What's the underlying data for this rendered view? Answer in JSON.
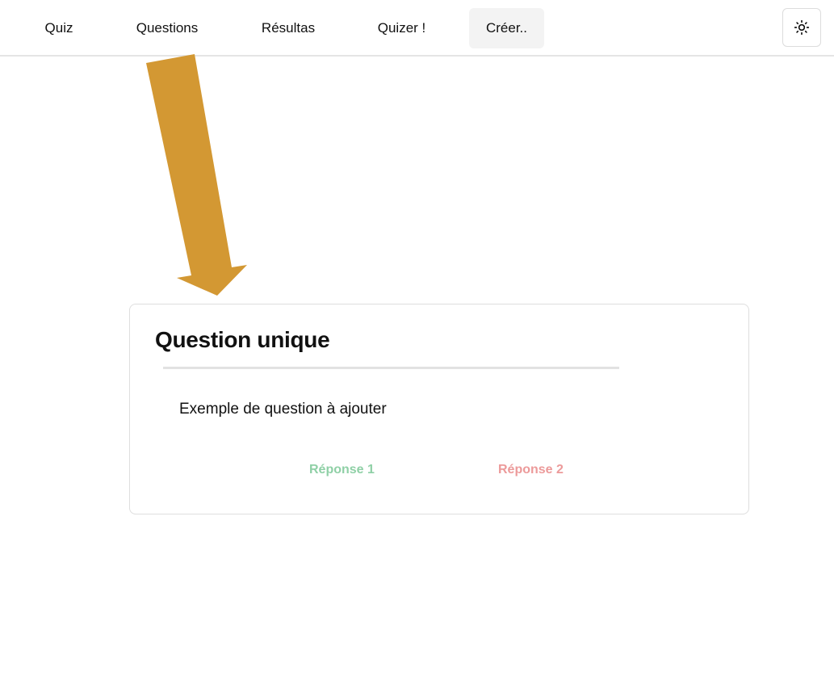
{
  "nav": {
    "items": [
      {
        "label": "Quiz"
      },
      {
        "label": "Questions"
      },
      {
        "label": "Résultas"
      },
      {
        "label": "Quizer !"
      },
      {
        "label": "Créer.."
      }
    ],
    "active_item": "Créer..",
    "theme_toggle_icon": "sun-icon"
  },
  "annotation": {
    "arrow_color": "#d39833",
    "arrow_icon": "arrow-down-icon"
  },
  "card": {
    "title": "Question unique",
    "question": "Exemple de question à ajouter",
    "answers": [
      {
        "label": "Réponse 1",
        "color": "#8fd0a6"
      },
      {
        "label": "Réponse 2",
        "color": "#ec9a9a"
      }
    ]
  }
}
